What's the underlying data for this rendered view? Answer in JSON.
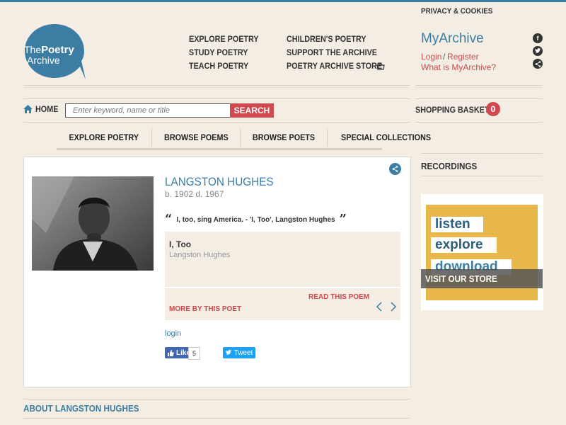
{
  "site": {
    "logo_text_1": "The",
    "logo_text_2": "Poetry",
    "logo_text_3": "Archive",
    "brand_color": "#3c7ea3",
    "accent_color": "#d0494f"
  },
  "header": {
    "privacy_label": "PRIVACY & COOKIES",
    "nav_col1": [
      "EXPLORE POETRY",
      "STUDY POETRY",
      "TEACH POETRY"
    ],
    "nav_col2": [
      "CHILDREN'S POETRY",
      "SUPPORT THE ARCHIVE",
      "POETRY ARCHIVE STORE"
    ],
    "myarchive": {
      "title": "MyArchive",
      "login": "Login",
      "separator": "/",
      "register": "Register",
      "what_is": "What is MyArchive?"
    },
    "social_icons": [
      "facebook-icon",
      "twitter-icon",
      "share-icon"
    ]
  },
  "search": {
    "home_label": "HOME",
    "placeholder": "Enter keyword, name or title",
    "button_label": "SEARCH",
    "basket_label": "SHOPPING BASKET",
    "basket_count": "0"
  },
  "tabs": [
    "EXPLORE POETRY",
    "BROWSE POEMS",
    "BROWSE POETS",
    "SPECIAL COLLECTIONS"
  ],
  "poet": {
    "name": "LANGSTON HUGHES",
    "dates": "b. 1902 d. 1967",
    "quote": "I, too, sing America. - 'I, Too', Langston Hughes",
    "poem_title": "I, Too",
    "poem_author": "Langston Hughes",
    "read_link": "READ THIS POEM",
    "more_link": "MORE BY THIS POET",
    "login_link": "login",
    "like_label": "Like",
    "like_count": "5",
    "tweet_label": "Tweet"
  },
  "sidebar": {
    "recordings_title": "RECORDINGS",
    "ad_words": [
      "listen",
      "explore",
      "download"
    ],
    "ad_cta": "VISIT OUR STORE"
  },
  "about": {
    "title": "ABOUT LANGSTON HUGHES"
  }
}
